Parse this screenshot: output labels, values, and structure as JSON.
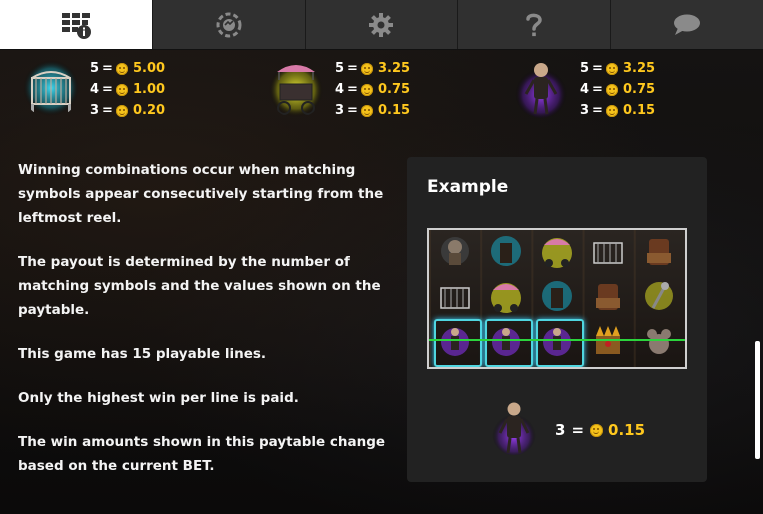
{
  "tabs": [
    {
      "name": "paytable-info",
      "icon": "paytable-info-icon",
      "active": true
    },
    {
      "name": "chips",
      "icon": "chip-icon",
      "active": false
    },
    {
      "name": "settings",
      "icon": "gear-icon",
      "active": false
    },
    {
      "name": "help",
      "icon": "question-icon",
      "active": false
    },
    {
      "name": "chat",
      "icon": "chat-bubble-icon",
      "active": false
    }
  ],
  "paytable": [
    {
      "symbol": "crib-symbol-icon",
      "rows": [
        {
          "count": "5",
          "eq": "=",
          "value": "5.00"
        },
        {
          "count": "4",
          "eq": "=",
          "value": "1.00"
        },
        {
          "count": "3",
          "eq": "=",
          "value": "0.20"
        }
      ]
    },
    {
      "symbol": "pram-symbol-icon",
      "rows": [
        {
          "count": "5",
          "eq": "=",
          "value": "3.25"
        },
        {
          "count": "4",
          "eq": "=",
          "value": "0.75"
        },
        {
          "count": "3",
          "eq": "=",
          "value": "0.15"
        }
      ]
    },
    {
      "symbol": "puppet-symbol-icon",
      "rows": [
        {
          "count": "5",
          "eq": "=",
          "value": "3.25"
        },
        {
          "count": "4",
          "eq": "=",
          "value": "0.75"
        },
        {
          "count": "3",
          "eq": "=",
          "value": "0.15"
        }
      ]
    }
  ],
  "description": [
    "Winning combinations occur when matching symbols appear consecutively starting from the leftmost reel.",
    "The payout is determined by the number of matching symbols and the values shown on the paytable.",
    "This game has 15 playable lines.",
    "Only the highest win per line is paid.",
    "The win amounts shown in this paytable change based on the current BET."
  ],
  "example": {
    "title": "Example",
    "count": "3",
    "eq": "=",
    "value": "0.15"
  },
  "colors": {
    "accent_gold": "#ffc81e",
    "win_line": "#2bd43c",
    "highlight": "#4fd6e0"
  }
}
